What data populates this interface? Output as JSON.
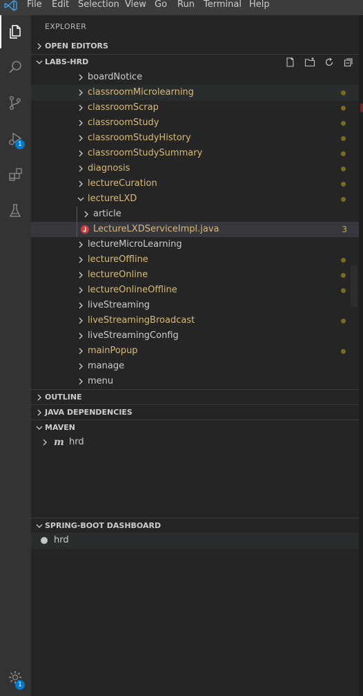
{
  "menubar": {
    "items": [
      "File",
      "Edit",
      "Selection",
      "View",
      "Go",
      "Run",
      "Terminal",
      "Help"
    ]
  },
  "activitybar": {
    "icons": [
      "explorer-icon",
      "search-icon",
      "source-control-icon",
      "run-debug-icon",
      "extensions-icon",
      "testing-icon",
      "settings-gear-icon"
    ],
    "run_debug_badge": "1",
    "settings_badge": "1"
  },
  "explorer": {
    "title": "EXPLORER",
    "sections": {
      "open_editors": "OPEN EDITORS",
      "workspace": "LABS-HRD",
      "outline": "OUTLINE",
      "java_dependencies": "JAVA DEPENDENCIES",
      "maven": "MAVEN",
      "spring_boot": "SPRING-BOOT DASHBOARD"
    },
    "tree": [
      {
        "name": "boardNotice",
        "modified": false
      },
      {
        "name": "classroomMicrolearning",
        "modified": true
      },
      {
        "name": "classroomScrap",
        "modified": true
      },
      {
        "name": "classroomStudy",
        "modified": true
      },
      {
        "name": "classroomStudyHistory",
        "modified": true
      },
      {
        "name": "classroomStudySummary",
        "modified": true
      },
      {
        "name": "diagnosis",
        "modified": true
      },
      {
        "name": "lectureCuration",
        "modified": true
      },
      {
        "name": "lectureLXD",
        "modified": true,
        "expanded": true
      },
      {
        "name": "article",
        "modified": false,
        "child": true
      },
      {
        "name": "LectureLXDServiceImpl.java",
        "modified": true,
        "child": true,
        "file": true,
        "problems": "3"
      },
      {
        "name": "lectureMicroLearning",
        "modified": false
      },
      {
        "name": "lectureOffline",
        "modified": true
      },
      {
        "name": "lectureOnline",
        "modified": true
      },
      {
        "name": "lectureOnlineOffline",
        "modified": true
      },
      {
        "name": "liveStreaming",
        "modified": false
      },
      {
        "name": "liveStreamingBroadcast",
        "modified": true
      },
      {
        "name": "liveStreamingConfig",
        "modified": false
      },
      {
        "name": "mainPopup",
        "modified": true
      },
      {
        "name": "manage",
        "modified": false
      },
      {
        "name": "menu",
        "modified": false
      }
    ],
    "maven_project": "hrd",
    "spring_boot_app": "hrd"
  },
  "colors": {
    "modified": "#d7ba7d",
    "badge": "#007acc",
    "error": "#e51400"
  }
}
